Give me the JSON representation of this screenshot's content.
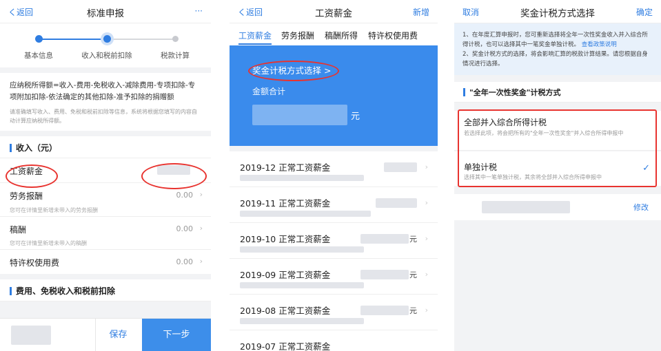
{
  "colors": {
    "accent": "#2f7de1",
    "hero_bg": "#3a8bec",
    "highlight": "#e8332f"
  },
  "screen1": {
    "nav": {
      "back": "く返回",
      "title": "标准申报",
      "more": "···"
    },
    "steps": [
      "基本信息",
      "收入和税前扣除",
      "税款计算"
    ],
    "formula": "应纳税所得额=收入-费用-免税收入-减除费用-专项扣除-专项附加扣除-依法确定的其他扣除-准予扣除的捐赠额",
    "formula_note": "请准确填写收入、费用、免税和税前扣除等信息，系统将根据您填写的内容自动计算应纳税所得额。",
    "income_section": "收入（元）",
    "rows": [
      {
        "label": "工资薪金",
        "value": "",
        "hint": ""
      },
      {
        "label": "劳务报酬",
        "value": "0.00",
        "hint": "您可在详情里新增未带入的劳务报酬"
      },
      {
        "label": "稿酬",
        "value": "0.00",
        "hint": "您可在详情里新增未带入的稿酬"
      },
      {
        "label": "特许权使用费",
        "value": "0.00",
        "hint": ""
      }
    ],
    "deduction_section": "费用、免税收入和税前扣除",
    "save": "保存",
    "next": "下一步"
  },
  "screen2": {
    "nav": {
      "back": "く返回",
      "title": "工资薪金",
      "add": "新增"
    },
    "tabs": [
      "工资薪金",
      "劳务报酬",
      "稿酬所得",
      "特许权使用费"
    ],
    "hero": {
      "link": "奖金计税方式选择 >",
      "total_label": "金额合计",
      "unit": "元"
    },
    "items": [
      {
        "title": "2019-12 正常工资薪金",
        "unit": ""
      },
      {
        "title": "2019-11 正常工资薪金",
        "unit": ""
      },
      {
        "title": "2019-10 正常工资薪金",
        "unit": "元"
      },
      {
        "title": "2019-09 正常工资薪金",
        "unit": "元"
      },
      {
        "title": "2019-08 正常工资薪金",
        "unit": "元"
      },
      {
        "title": "2019-07 正常工资薪金",
        "unit": ""
      }
    ]
  },
  "screen3": {
    "nav": {
      "cancel": "取消",
      "title": "奖金计税方式选择",
      "confirm": "确定"
    },
    "notice_1": "1、在年度汇算申报时，您可重新选择将全年一次性奖金收入并入综合所得计税，也可以选择其中一笔奖金单独计税。",
    "notice_link": "查看政策说明",
    "notice_2": "2、奖金计税方式的选择，将会影响汇算的税款计算结果。请您根据自身情况进行选择。",
    "method_title": "\"全年一次性奖金\"计税方式",
    "options": [
      {
        "title": "全部并入综合所得计税",
        "desc": "若选择此项，将会把所有的\"全年一次性奖金\"并入综合所得申报中",
        "selected": false
      },
      {
        "title": "单独计税",
        "desc": "选择其中一笔单独计税，其余将全部并入综合所得申报中",
        "selected": true
      }
    ],
    "modify": "修改"
  }
}
